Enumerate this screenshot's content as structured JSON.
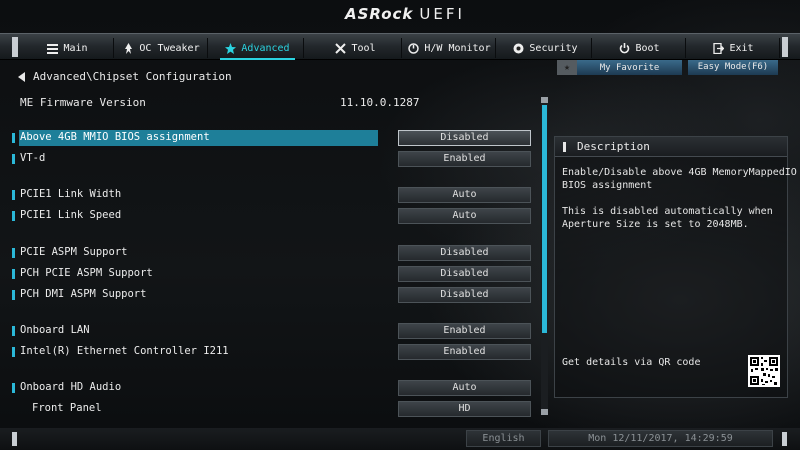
{
  "header": {
    "brand": "ASRock",
    "product": "UEFI"
  },
  "nav": {
    "tabs": [
      {
        "label": "Main",
        "icon": "list-icon"
      },
      {
        "label": "OC Tweaker",
        "icon": "rocket-icon"
      },
      {
        "label": "Advanced",
        "icon": "star-icon",
        "active": true
      },
      {
        "label": "Tool",
        "icon": "tools-icon"
      },
      {
        "label": "H/W Monitor",
        "icon": "monitor-icon"
      },
      {
        "label": "Security",
        "icon": "shield-icon"
      },
      {
        "label": "Boot",
        "icon": "power-icon"
      },
      {
        "label": "Exit",
        "icon": "exit-icon"
      }
    ]
  },
  "buttons": {
    "my_favorite": "My Favorite",
    "easy_mode": "Easy Mode(F6)"
  },
  "breadcrumb": "Advanced\\Chipset Configuration",
  "firmware": {
    "label": "ME Firmware Version",
    "value": "11.10.0.1287"
  },
  "settings": [
    {
      "label": "Above 4GB MMIO BIOS assignment",
      "value": "Disabled",
      "selected": true
    },
    {
      "label": "VT-d",
      "value": "Enabled"
    },
    {
      "label": "PCIE1 Link Width",
      "value": "Auto"
    },
    {
      "label": "PCIE1 Link Speed",
      "value": "Auto"
    },
    {
      "label": "PCIE ASPM Support",
      "value": "Disabled"
    },
    {
      "label": "PCH PCIE ASPM Support",
      "value": "Disabled"
    },
    {
      "label": "PCH DMI ASPM Support",
      "value": "Disabled"
    },
    {
      "label": "Onboard LAN",
      "value": "Enabled"
    },
    {
      "label": "Intel(R) Ethernet Controller I211",
      "value": "Enabled"
    },
    {
      "label": "Onboard HD Audio",
      "value": "Auto"
    },
    {
      "label": "Front Panel",
      "value": "HD"
    }
  ],
  "description": {
    "title": "Description",
    "lines": [
      "Enable/Disable above 4GB MemoryMappedIO",
      "BIOS assignment",
      "",
      "This is disabled automatically when",
      "Aperture Size is set to 2048MB."
    ],
    "qr_text": "Get details via QR code"
  },
  "footer": {
    "language": "English",
    "datetime": "Mon 12/11/2017, 14:29:59"
  },
  "colors": {
    "accent": "#2bd3e0",
    "selection": "#1e7f99",
    "marker": "#2bb8d8"
  }
}
